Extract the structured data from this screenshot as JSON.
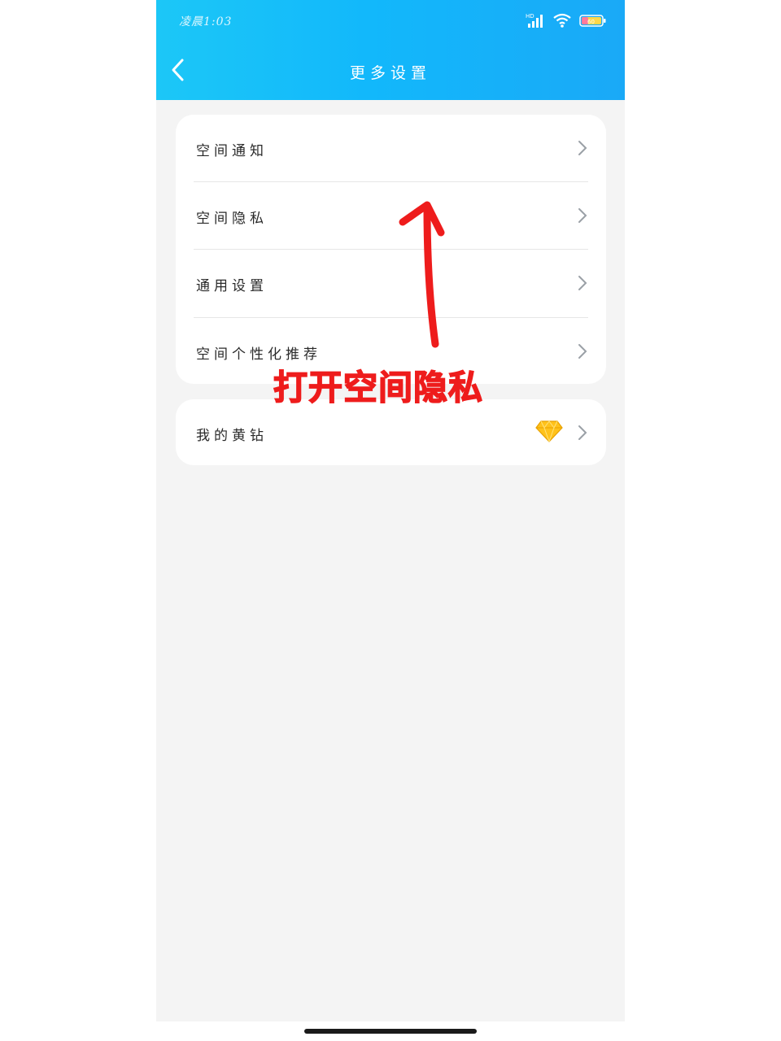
{
  "status_bar": {
    "time": "凌晨1:03",
    "network_badge": "HD",
    "icons": [
      "signal-icon",
      "wifi-icon",
      "battery-icon"
    ],
    "battery_text": "60"
  },
  "header": {
    "title": "更多设置",
    "back_icon": "chevron-left-icon"
  },
  "settings": {
    "group1": [
      {
        "label": "空间通知"
      },
      {
        "label": "空间隐私"
      },
      {
        "label": "通用设置"
      },
      {
        "label": "空间个性化推荐"
      }
    ],
    "group2": [
      {
        "label": "我的黄钻",
        "icon": "yellow-diamond-icon"
      }
    ]
  },
  "annotation": {
    "text": "打开空间隐私",
    "color": "#ee1c1c"
  },
  "colors": {
    "header_gradient_start": "#1cc7f7",
    "header_gradient_end": "#1aa9f7",
    "background": "#f4f4f4",
    "card": "#ffffff"
  }
}
